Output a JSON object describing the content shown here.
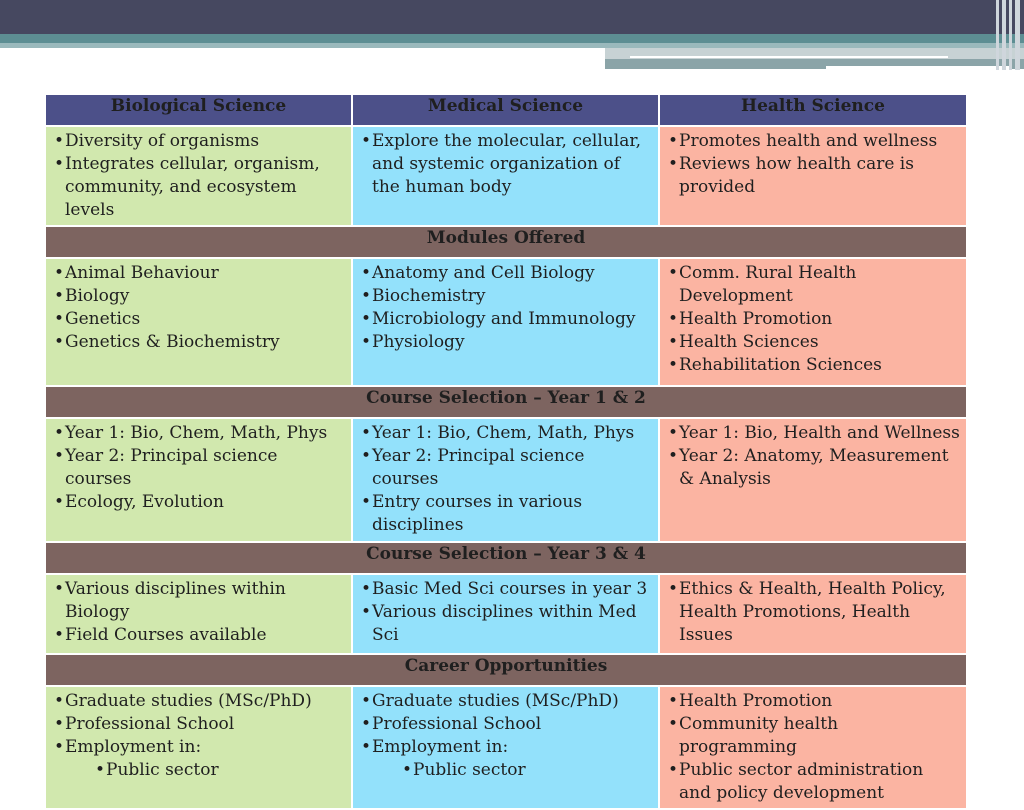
{
  "columns": [
    "Biological Science",
    "Medical Science",
    "Health Science"
  ],
  "overview": {
    "bio": [
      "Diversity of organisms",
      "Integrates cellular, organism, community, and ecosystem levels"
    ],
    "med": [
      "Explore the molecular, cellular, and systemic organization of the human body"
    ],
    "hlt": [
      "Promotes health and wellness",
      "Reviews how health care is provided"
    ]
  },
  "sections": {
    "modules": {
      "title": "Modules Offered",
      "bio": [
        "Animal Behaviour",
        "Biology",
        "Genetics",
        "Genetics & Biochemistry"
      ],
      "med": [
        "Anatomy and Cell Biology",
        "Biochemistry",
        "Microbiology and Immunology",
        "Physiology"
      ],
      "hlt": [
        "Comm. Rural Health Development",
        "Health Promotion",
        "Health Sciences",
        "Rehabilitation Sciences"
      ]
    },
    "year12": {
      "title": "Course Selection – Year 1 & 2",
      "bio": [
        "Year 1: Bio, Chem, Math, Phys",
        "Year 2: Principal science courses",
        "Ecology, Evolution"
      ],
      "med": [
        "Year 1: Bio, Chem, Math, Phys",
        "Year 2: Principal science courses",
        "Entry courses in various disciplines"
      ],
      "hlt": [
        "Year 1: Bio, Health and Wellness",
        "Year 2: Anatomy, Measurement & Analysis"
      ]
    },
    "year34": {
      "title": "Course Selection – Year 3 & 4",
      "bio": [
        "Various disciplines within Biology",
        "Field Courses available"
      ],
      "med": [
        "Basic Med Sci courses in year 3",
        "Various disciplines within Med Sci"
      ],
      "hlt": [
        "Ethics & Health, Health Policy, Health Promotions, Health Issues"
      ]
    },
    "career": {
      "title": "Career Opportunities",
      "bio": [
        "Graduate studies (MSc/PhD)",
        "Professional School",
        "Employment in:"
      ],
      "bio_sub": [
        "Public sector"
      ],
      "med": [
        "Graduate studies (MSc/PhD)",
        "Professional School",
        "Employment in:"
      ],
      "med_sub": [
        "Public sector"
      ],
      "hlt": [
        "Health Promotion",
        "Community health programming",
        "Public sector administration and policy development"
      ]
    }
  },
  "colors": {
    "header": "#4c5089",
    "section": "#7d6460",
    "bio": "#d1e8ae",
    "med": "#93e1fb",
    "health": "#fbb4a2"
  }
}
